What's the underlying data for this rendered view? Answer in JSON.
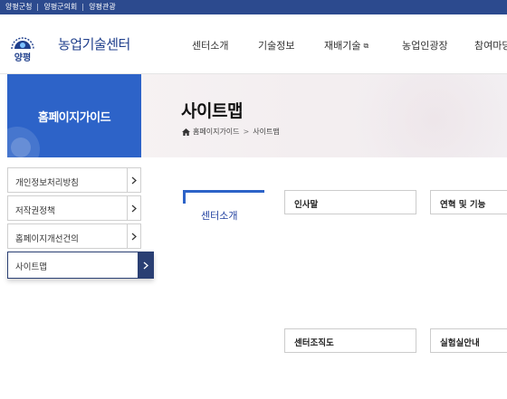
{
  "topbar": {
    "links": [
      "양평군청",
      "양평군의회",
      "양평관광"
    ]
  },
  "header": {
    "logo_text": "양평",
    "site_title": "농업기술센터",
    "nav": [
      {
        "label": "센터소개",
        "external": false
      },
      {
        "label": "기술정보",
        "external": false
      },
      {
        "label": "재배기술",
        "external": true
      },
      {
        "label": "농업인광장",
        "external": false
      },
      {
        "label": "참여마당",
        "external": false
      }
    ]
  },
  "lnb": {
    "title": "홈페이지가이드",
    "items": [
      {
        "label": "개인정보처리방침",
        "active": false
      },
      {
        "label": "저작권정책",
        "active": false
      },
      {
        "label": "홈페이지개선건의",
        "active": false
      },
      {
        "label": "사이트맵",
        "active": true
      }
    ]
  },
  "content": {
    "page_title": "사이트맵",
    "breadcrumb": [
      "홈페이지가이드",
      "사이트맵"
    ],
    "section": {
      "title": "센터소개",
      "boxes": [
        "인사말",
        "연혁 및 기능",
        "센터조직도",
        "실험실안내"
      ]
    }
  },
  "colors": {
    "top_bar": "#2c4a8e",
    "brand_blue": "#2d63c8",
    "active_navy": "#2a3f73"
  }
}
